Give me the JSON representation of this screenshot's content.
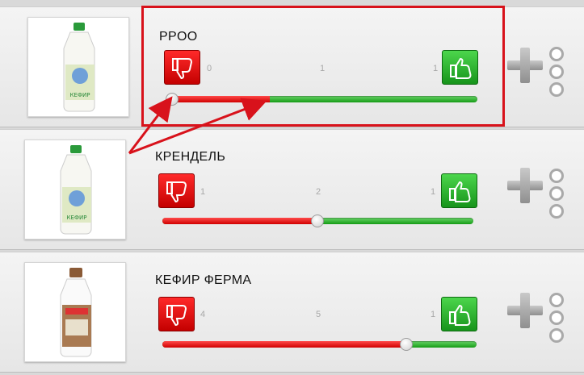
{
  "items": [
    {
      "title": "PPOO",
      "down_count": "0",
      "total": "1",
      "up_count": "1",
      "level": 0.0
    },
    {
      "title": "КРЕНДЕЛЬ",
      "down_count": "1",
      "total": "2",
      "up_count": "1",
      "level": 0.5
    },
    {
      "title": "КЕФИР ФЕРМА",
      "down_count": "4",
      "total": "5",
      "up_count": "1",
      "level": 0.8
    },
    {
      "product_label": "КЕФИР"
    }
  ],
  "colors": {
    "negative": "#e01010",
    "positive": "#22a822",
    "annotation": "#d8121b"
  }
}
